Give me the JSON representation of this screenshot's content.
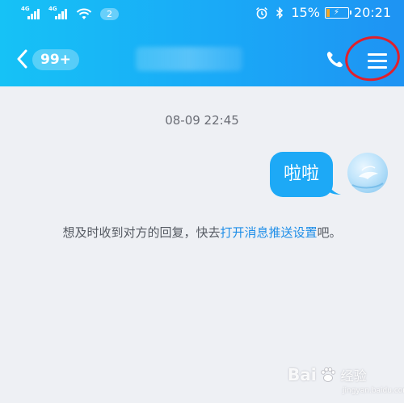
{
  "status_bar": {
    "sim1_network": "4G",
    "sim2_network": "4G",
    "notification_count": "2",
    "battery_percent": "15%",
    "time": "20:21",
    "icons": [
      "alarm-icon",
      "bluetooth-icon",
      "battery-icon"
    ]
  },
  "header": {
    "unread_count": "99+",
    "colors": {
      "gradient_start": "#16c2f6",
      "gradient_end": "#1e93f3"
    }
  },
  "chat": {
    "timestamp": "08-09 22:45",
    "messages": [
      {
        "sender": "me",
        "text": "啦啦"
      }
    ],
    "notice_prefix": "想及时收到对方的回复，快去",
    "notice_link": "打开消息推送设置",
    "notice_suffix": "吧。",
    "colors": {
      "bubble": "#1da9f6",
      "link": "#1e8ee8"
    }
  },
  "watermark": {
    "brand": "Bai",
    "brand_suffix": "经验",
    "url": "jingyan.baidu.com"
  }
}
